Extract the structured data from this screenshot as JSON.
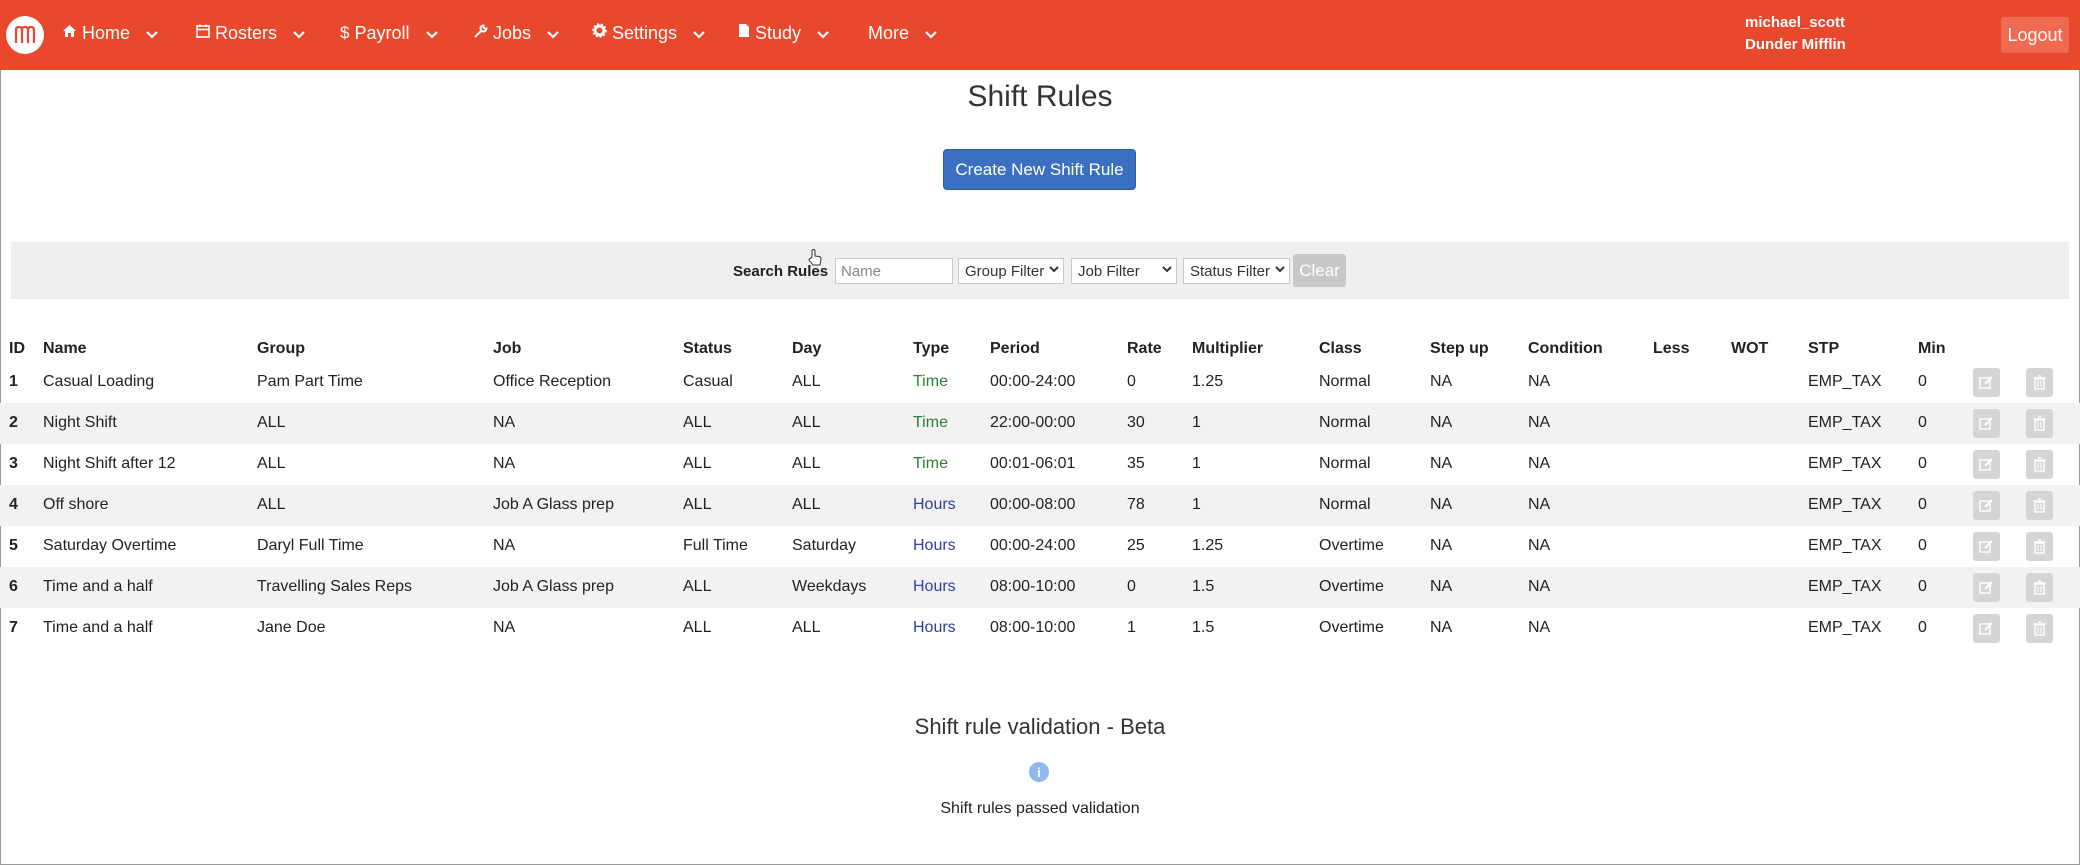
{
  "nav": {
    "items": [
      {
        "label": "Home",
        "icon": "home-icon"
      },
      {
        "label": "Rosters",
        "icon": "calendar-icon"
      },
      {
        "label": "Payroll",
        "icon": "dollar-icon"
      },
      {
        "label": "Jobs",
        "icon": "wrench-icon"
      },
      {
        "label": "Settings",
        "icon": "gear-icon"
      },
      {
        "label": "Study",
        "icon": "file-icon"
      },
      {
        "label": "More",
        "icon": ""
      }
    ],
    "user_name": "michael_scott",
    "company": "Dunder Mifflin",
    "logout": "Logout"
  },
  "page": {
    "title": "Shift Rules",
    "create_button": "Create New Shift Rule"
  },
  "search": {
    "label": "Search Rules",
    "name_placeholder": "Name",
    "group_filter": "Group Filter",
    "job_filter": "Job Filter",
    "status_filter": "Status Filter",
    "clear": "Clear"
  },
  "table": {
    "headers": [
      "ID",
      "Name",
      "Group",
      "Job",
      "Status",
      "Day",
      "Type",
      "Period",
      "Rate",
      "Multiplier",
      "Class",
      "Step up",
      "Condition",
      "Less",
      "WOT",
      "STP",
      "Min"
    ],
    "rows": [
      [
        "1",
        "Casual Loading",
        "Pam Part Time",
        "Office Reception",
        "Casual",
        "ALL",
        "Time",
        "00:00-24:00",
        "0",
        "1.25",
        "Normal",
        "NA",
        "NA",
        "",
        "",
        "EMP_TAX",
        "0"
      ],
      [
        "2",
        "Night Shift",
        "ALL",
        "NA",
        "ALL",
        "ALL",
        "Time",
        "22:00-00:00",
        "30",
        "1",
        "Normal",
        "NA",
        "NA",
        "",
        "",
        "EMP_TAX",
        "0"
      ],
      [
        "3",
        "Night Shift after 12",
        "ALL",
        "NA",
        "ALL",
        "ALL",
        "Time",
        "00:01-06:01",
        "35",
        "1",
        "Normal",
        "NA",
        "NA",
        "",
        "",
        "EMP_TAX",
        "0"
      ],
      [
        "4",
        "Off shore",
        "ALL",
        "Job A Glass prep",
        "ALL",
        "ALL",
        "Hours",
        "00:00-08:00",
        "78",
        "1",
        "Normal",
        "NA",
        "NA",
        "",
        "",
        "EMP_TAX",
        "0"
      ],
      [
        "5",
        "Saturday Overtime",
        "Daryl Full Time",
        "NA",
        "Full Time",
        "Saturday",
        "Hours",
        "00:00-24:00",
        "25",
        "1.25",
        "Overtime",
        "NA",
        "NA",
        "",
        "",
        "EMP_TAX",
        "0"
      ],
      [
        "6",
        "Time and a half",
        "Travelling Sales Reps",
        "Job A Glass prep",
        "ALL",
        "Weekdays",
        "Hours",
        "08:00-10:00",
        "0",
        "1.5",
        "Overtime",
        "NA",
        "NA",
        "",
        "",
        "EMP_TAX",
        "0"
      ],
      [
        "7",
        "Time and a half",
        "Jane Doe",
        "NA",
        "ALL",
        "ALL",
        "Hours",
        "08:00-10:00",
        "1",
        "1.5",
        "Overtime",
        "NA",
        "NA",
        "",
        "",
        "EMP_TAX",
        "0"
      ]
    ]
  },
  "validation": {
    "title": "Shift rule validation - Beta",
    "info_icon": "i",
    "message": "Shift rules passed validation"
  },
  "colors": {
    "brand": "#e8482b",
    "primary_button": "#3b70c0",
    "type_time": "#2e7d32",
    "type_hours": "#2d3fa8"
  }
}
